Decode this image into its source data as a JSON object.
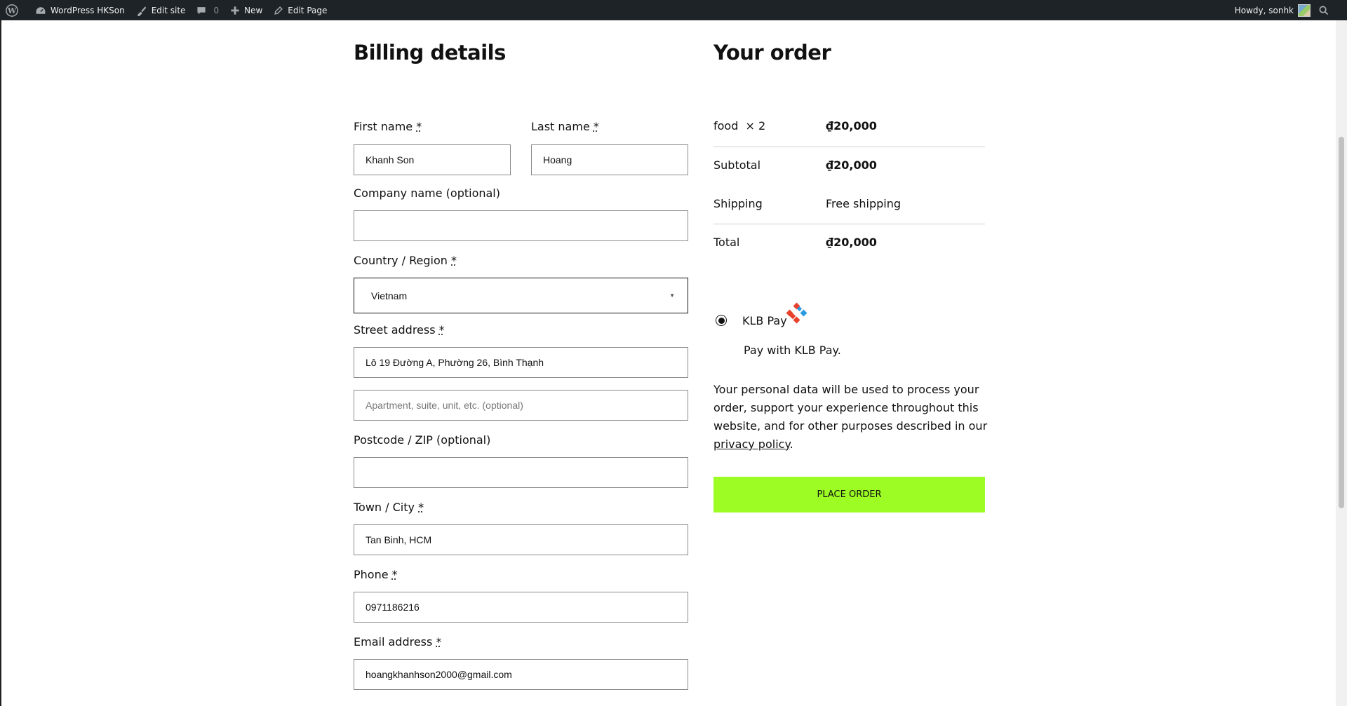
{
  "admin_bar": {
    "site_name": "WordPress HKSon",
    "edit_site": "Edit site",
    "comments_count": "0",
    "new": "New",
    "edit_page": "Edit Page",
    "howdy": "Howdy, sonhk"
  },
  "billing": {
    "heading": "Billing details",
    "first_name": {
      "label": "First name",
      "value": "Khanh Son"
    },
    "last_name": {
      "label": "Last name",
      "value": "Hoang"
    },
    "company": {
      "label": "Company name (optional)",
      "value": ""
    },
    "country": {
      "label": "Country / Region",
      "value": "Vietnam"
    },
    "street": {
      "label": "Street address",
      "value": "Lô 19 Đường A, Phường 26, Bình Thạnh",
      "placeholder2": "Apartment, suite, unit, etc. (optional)"
    },
    "postcode": {
      "label": "Postcode / ZIP (optional)",
      "value": ""
    },
    "city": {
      "label": "Town / City",
      "value": "Tan Binh, HCM"
    },
    "phone": {
      "label": "Phone",
      "value": "0971186216"
    },
    "email": {
      "label": "Email address",
      "value": "hoangkhanhson2000@gmail.com"
    },
    "required_mark": "*"
  },
  "order": {
    "heading": "Your order",
    "item_name": "food",
    "item_qty": "× 2",
    "item_price": "₫20,000",
    "subtotal_label": "Subtotal",
    "subtotal_value": "₫20,000",
    "shipping_label": "Shipping",
    "shipping_value": "Free shipping",
    "total_label": "Total",
    "total_value": "₫20,000",
    "payment_method": "KLB Pay",
    "payment_description": "Pay with KLB Pay.",
    "privacy_text": "Your personal data will be used to process your order, support your experience throughout this website, and for other purposes described in our ",
    "privacy_link": "privacy policy",
    "privacy_end": ".",
    "place_order": "PLACE ORDER"
  },
  "colors": {
    "admin_bar_bg": "#1d2327",
    "place_order_bg": "#9cfc24"
  }
}
